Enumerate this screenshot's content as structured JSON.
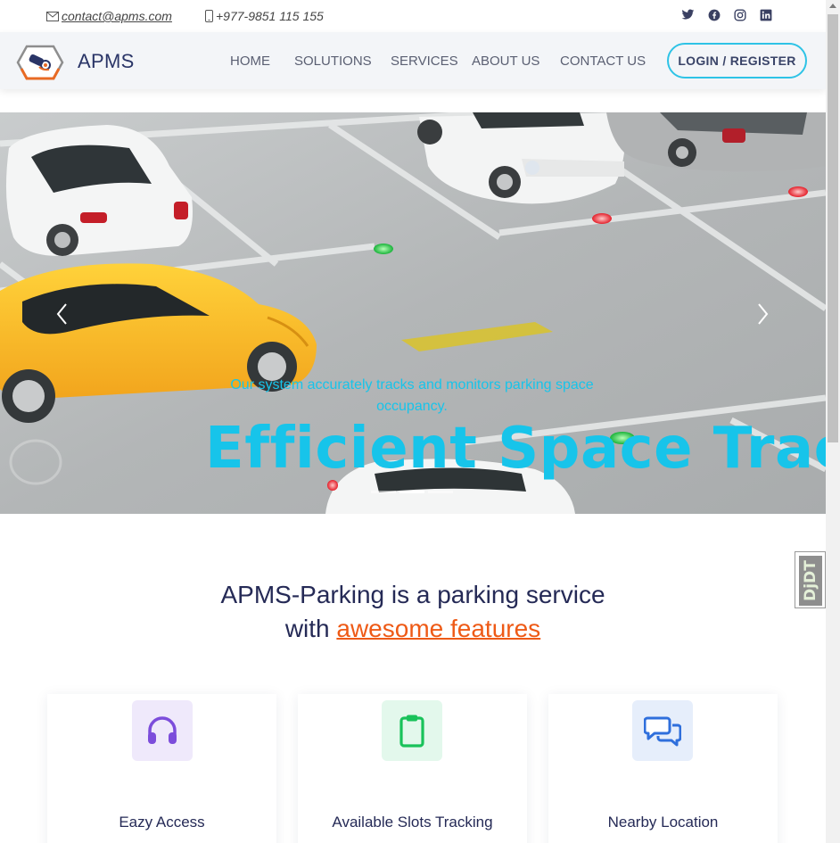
{
  "topbar": {
    "email": "contact@apms.com",
    "phone": "+977-9851 115 155",
    "social_icons": [
      "twitter-icon",
      "facebook-icon",
      "instagram-icon",
      "linkedin-icon"
    ]
  },
  "header": {
    "brand": "APMS",
    "nav": [
      "HOME",
      "SOLUTIONS",
      "SERVICES",
      "ABOUT US",
      "CONTACT US"
    ],
    "login_label": "LOGIN / REGISTER"
  },
  "hero": {
    "title": "Efficient Space Trackin",
    "subtitle": "Our system accurately tracks and monitors parking space occupancy.",
    "slide_count": 3,
    "active_slide": 2
  },
  "side_widget": {
    "label": "DjDT"
  },
  "features": {
    "heading_line1": "APMS-Parking is a parking service",
    "heading_line2_prefix": "with",
    "heading_highlight": "awesome features",
    "cards": [
      {
        "label": "Eazy Access",
        "icon": "headphones-icon",
        "icon_color": "#7c4ddb",
        "bg": "#efe9fb"
      },
      {
        "label": "Available Slots Tracking",
        "icon": "clipboard-icon",
        "icon_color": "#19c25a",
        "bg": "#e3f8ec"
      },
      {
        "label": "Nearby Location",
        "icon": "chat-bubbles-icon",
        "icon_color": "#2f6fdc",
        "bg": "#e6eefb"
      }
    ]
  },
  "colors": {
    "accent_cyan": "#17c4ea",
    "accent_orange": "#ee5a16",
    "navy": "#252a56"
  }
}
